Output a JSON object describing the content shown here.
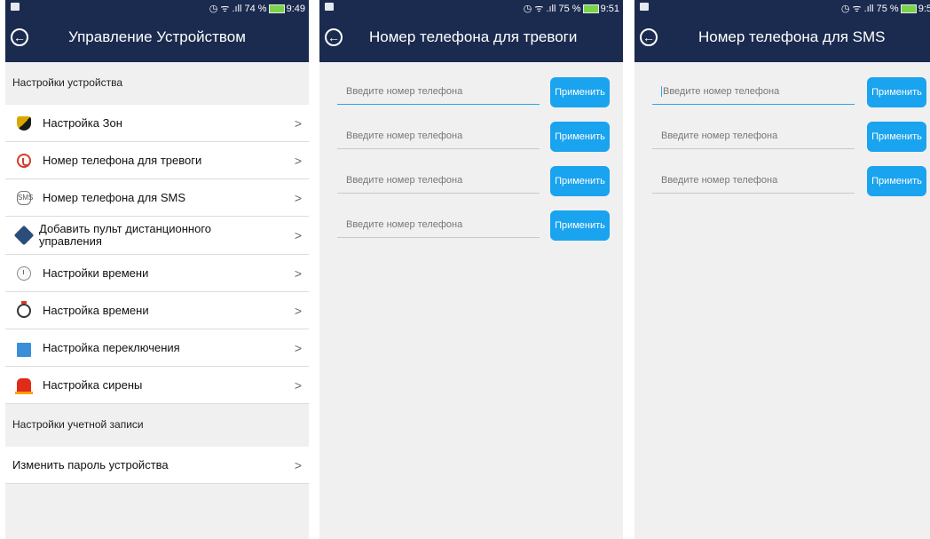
{
  "screen1": {
    "status": "9:49",
    "battery": "74 %",
    "title": "Управление Устройством",
    "section1": "Настройки устройства",
    "items": [
      {
        "label": "Настройка Зон",
        "icon": "zone-shield-icon"
      },
      {
        "label": "Номер телефона для тревоги",
        "icon": "phone-icon"
      },
      {
        "label": "Номер телефона для SMS",
        "icon": "sms-icon"
      },
      {
        "label": "Добавить пульт дистанционного управления",
        "icon": "remote-icon"
      },
      {
        "label": "Настройки времени",
        "icon": "clock-icon"
      },
      {
        "label": "Настройка времени",
        "icon": "timer-icon"
      },
      {
        "label": "Настройка переключения",
        "icon": "switch-icon"
      },
      {
        "label": "Настройка сирены",
        "icon": "siren-icon"
      }
    ],
    "section2": "Настройки учетной записи",
    "account_items": [
      {
        "label": "Изменить пароль устройства"
      }
    ]
  },
  "screen2": {
    "status": "9:51",
    "battery": "75 %",
    "title": "Номер телефона для тревоги",
    "placeholder": "Введите номер телефона",
    "apply_label": "Применить",
    "field_count": 4
  },
  "screen3": {
    "status": "9:5",
    "battery": "75 %",
    "title": "Номер телефона для SMS",
    "placeholder": "Введите номер телефона",
    "apply_label": "Применить",
    "field_count": 3
  },
  "colors": {
    "appbar": "#1b2b4f",
    "accent": "#1aa3ee"
  }
}
